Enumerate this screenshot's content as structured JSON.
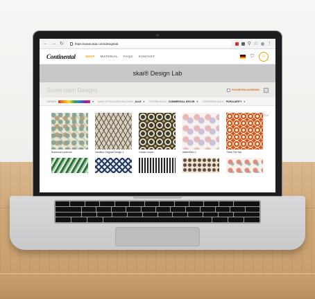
{
  "browser": {
    "url": "https://www.skai.com/designlab"
  },
  "site": {
    "brand": "Continental",
    "nav": [
      {
        "label": "SHOP",
        "active": true
      },
      {
        "label": "MATERIAL",
        "active": false
      },
      {
        "label": "FAQS",
        "active": false
      },
      {
        "label": "KONTAKT",
        "active": false
      }
    ],
    "accent_color": "#e8a400"
  },
  "banner": {
    "title": "skai® Design Lab"
  },
  "search": {
    "placeholder": "Suche nach Designs",
    "favorites_label": "FAVORITEN ANZEIGEN"
  },
  "filters": {
    "color_label": "FARBEN",
    "style_label": "NACH STYLE DURCHSUCHEN",
    "style_value": "ALLE",
    "filter_label": "FILTERN NACH",
    "filter_value": "COMMERCIAL DECOR",
    "sort_label": "SORTIEREN NACH",
    "sort_value": "POPULARITY",
    "reset_label": "ZURÜCKSETZEN"
  },
  "patterns": [
    {
      "name": "Botanical sunburst"
    },
    {
      "name": "Nautilus Original Design 1"
    },
    {
      "name": "Golden tropic"
    },
    {
      "name": "Waterlilies 2"
    },
    {
      "name": "Tribal Tile Nut"
    },
    {
      "name": ""
    },
    {
      "name": ""
    },
    {
      "name": ""
    },
    {
      "name": ""
    },
    {
      "name": ""
    }
  ]
}
